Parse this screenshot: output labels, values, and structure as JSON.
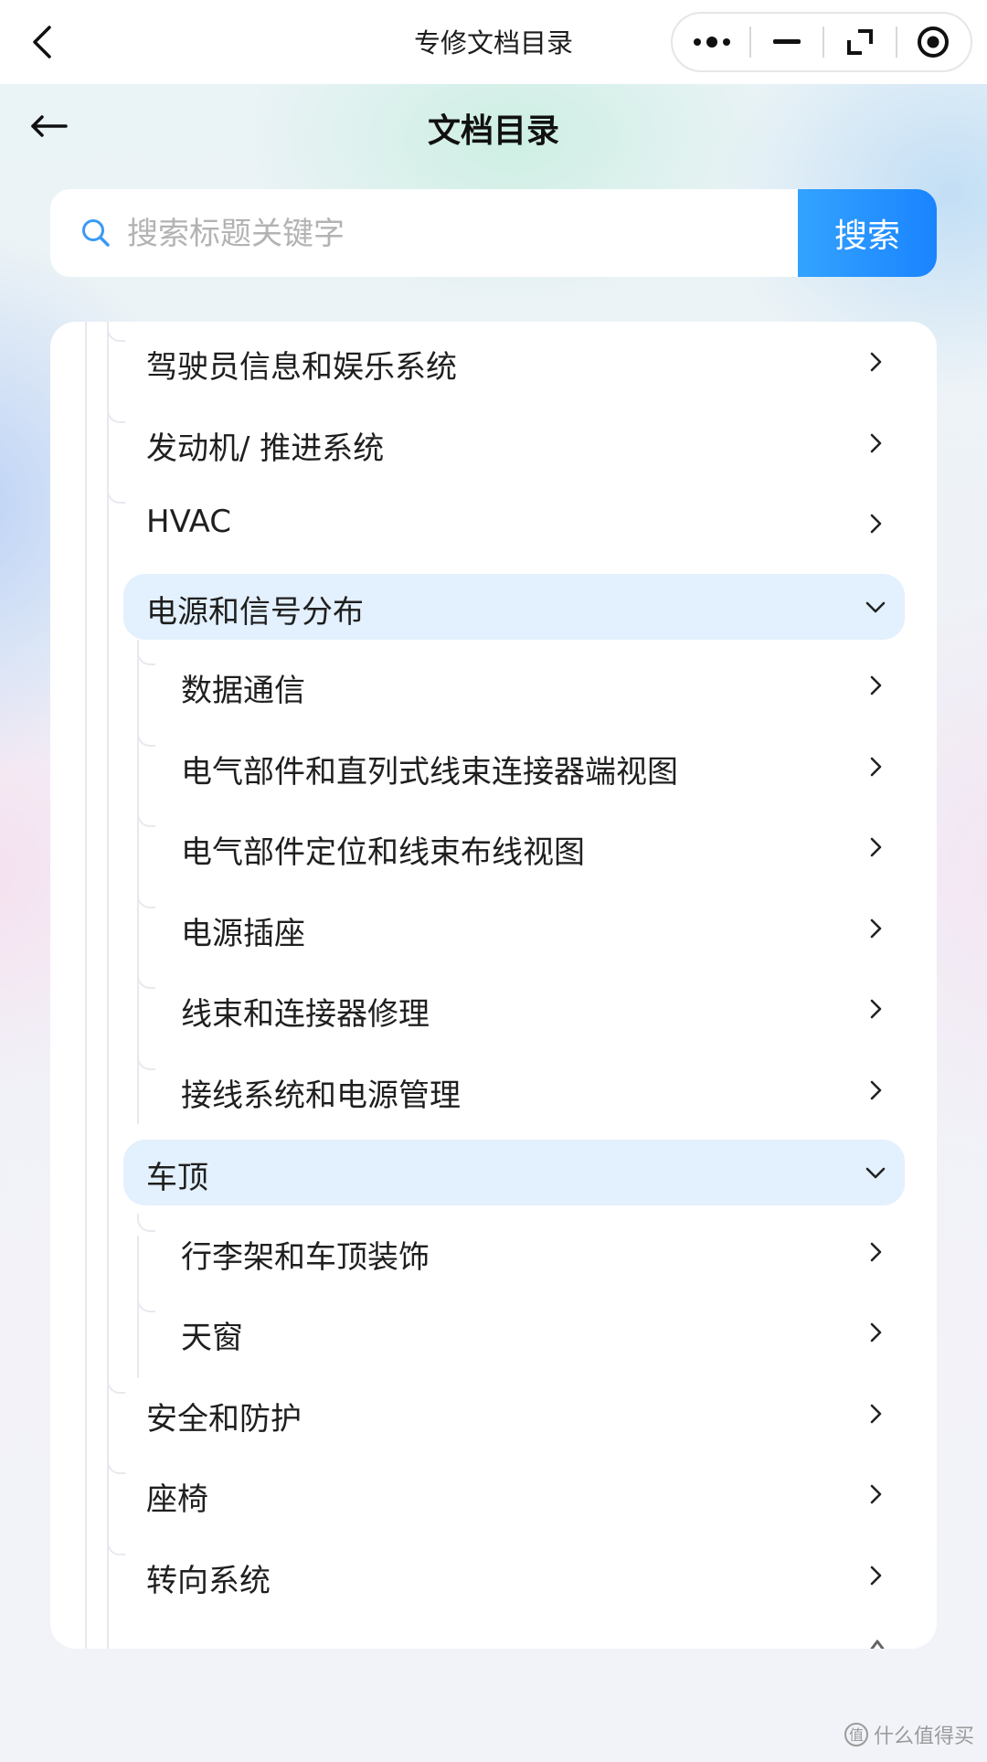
{
  "topbar": {
    "title": "专修文档目录"
  },
  "header": {
    "title": "文档目录"
  },
  "search": {
    "placeholder": "搜索标题关键字",
    "button_label": "搜索"
  },
  "tree": {
    "items": [
      {
        "label": "驾驶员信息和娱乐系统",
        "level": 1,
        "expanded": false
      },
      {
        "label": "发动机/ 推进系统",
        "level": 1,
        "expanded": false
      },
      {
        "label": "HVAC",
        "level": 1,
        "expanded": false
      },
      {
        "label": "电源和信号分布",
        "level": 1,
        "expanded": true
      },
      {
        "label": "数据通信",
        "level": 2,
        "expanded": false
      },
      {
        "label": "电气部件和直列式线束连接器端视图",
        "level": 2,
        "expanded": false
      },
      {
        "label": "电气部件定位和线束布线视图",
        "level": 2,
        "expanded": false
      },
      {
        "label": "电源插座",
        "level": 2,
        "expanded": false
      },
      {
        "label": "线束和连接器修理",
        "level": 2,
        "expanded": false
      },
      {
        "label": "接线系统和电源管理",
        "level": 2,
        "expanded": false
      },
      {
        "label": "车顶",
        "level": 1,
        "expanded": true
      },
      {
        "label": "行李架和车顶装饰",
        "level": 2,
        "expanded": false
      },
      {
        "label": "天窗",
        "level": 2,
        "expanded": false
      },
      {
        "label": "安全和防护",
        "level": 1,
        "expanded": false
      },
      {
        "label": "座椅",
        "level": 1,
        "expanded": false
      },
      {
        "label": "转向系统",
        "level": 1,
        "expanded": false
      }
    ]
  },
  "watermark": {
    "badge": "值",
    "text": "什么值得买"
  },
  "colors": {
    "accent": "#1a84ff",
    "selected_bg": "#e3f0fd"
  }
}
